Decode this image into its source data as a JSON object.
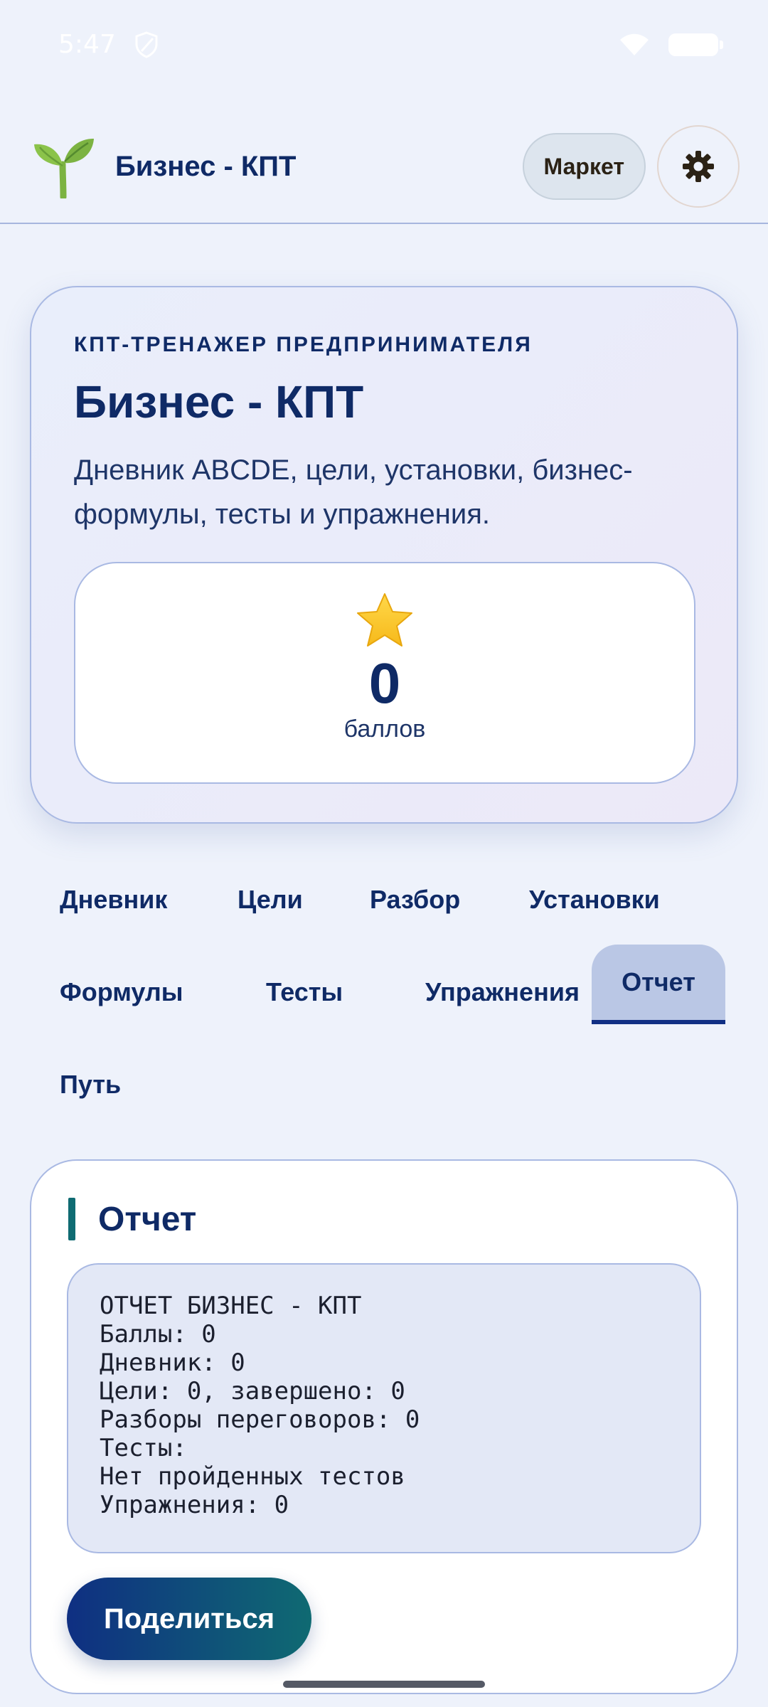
{
  "status_bar": {
    "time": "5:47"
  },
  "header": {
    "app_title": "Бизнес - КПТ",
    "market_label": "Маркет"
  },
  "hero": {
    "kicker": "КПТ-ТРЕНАЖЕР ПРЕДПРИНИМАТЕЛЯ",
    "title": "Бизнес - КПТ",
    "description": "Дневник ABCDE, цели, установки, бизнес-формулы, тесты и упражнения.",
    "score_value": "0",
    "score_label": "баллов"
  },
  "tabs": [
    {
      "label": "Дневник",
      "active": false
    },
    {
      "label": "Цели",
      "active": false
    },
    {
      "label": "Разбор",
      "active": false
    },
    {
      "label": "Установки",
      "active": false
    },
    {
      "label": "Формулы",
      "active": false
    },
    {
      "label": "Тесты",
      "active": false
    },
    {
      "label": "Упражнения",
      "active": false
    },
    {
      "label": "Отчет",
      "active": true
    },
    {
      "label": "Путь",
      "active": false
    }
  ],
  "report": {
    "title": "Отчет",
    "lines": [
      "ОТЧЕТ БИЗНЕС - КПТ",
      "Баллы: 0",
      "Дневник: 0",
      "Цели: 0, завершено: 0",
      "Разборы переговоров: 0",
      "Тесты:",
      "Нет пройденных тестов",
      "Упражнения: 0"
    ],
    "share_label": "Поделиться"
  },
  "colors": {
    "background": "#eef2fb",
    "primary_text": "#0f2a66",
    "accent": "#0f6b72",
    "active_tab": "#bac7e5"
  },
  "icons": {
    "logo": "sprout-icon",
    "settings": "gear-icon",
    "score": "star-icon"
  }
}
